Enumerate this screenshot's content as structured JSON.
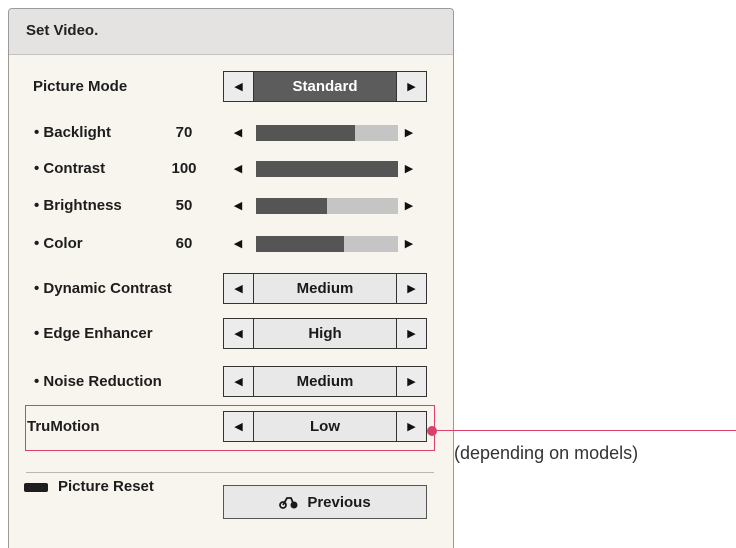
{
  "header": {
    "title": "Set Video."
  },
  "picture_mode": {
    "label": "Picture Mode",
    "value": "Standard"
  },
  "sliders": [
    {
      "label": "• Backlight",
      "value": "70",
      "level": 0.7
    },
    {
      "label": "• Contrast",
      "value": "100",
      "level": 1.0
    },
    {
      "label": "• Brightness",
      "value": "50",
      "level": 0.5
    },
    {
      "label": "• Color",
      "value": "60",
      "level": 0.62
    }
  ],
  "options": [
    {
      "label": "• Dynamic Contrast",
      "value": "Medium"
    },
    {
      "label": "• Edge Enhancer",
      "value": "High"
    },
    {
      "label": "• Noise Reduction",
      "value": "Medium"
    }
  ],
  "trumotion": {
    "label": "TruMotion",
    "value": "Low"
  },
  "footer": {
    "reset_label": "Picture Reset",
    "previous_label": "Previous"
  },
  "callout": {
    "text": "(depending on models)"
  },
  "icons": {
    "left_arrow": "◀",
    "right_arrow": "▶",
    "reset_key": "red-key-icon",
    "back": "back-icon"
  },
  "colors": {
    "highlight": "#d9406a",
    "active_value_bg": "#5c5c5c",
    "slider_fill": "#555555",
    "slider_track": "#c5c5c5"
  }
}
